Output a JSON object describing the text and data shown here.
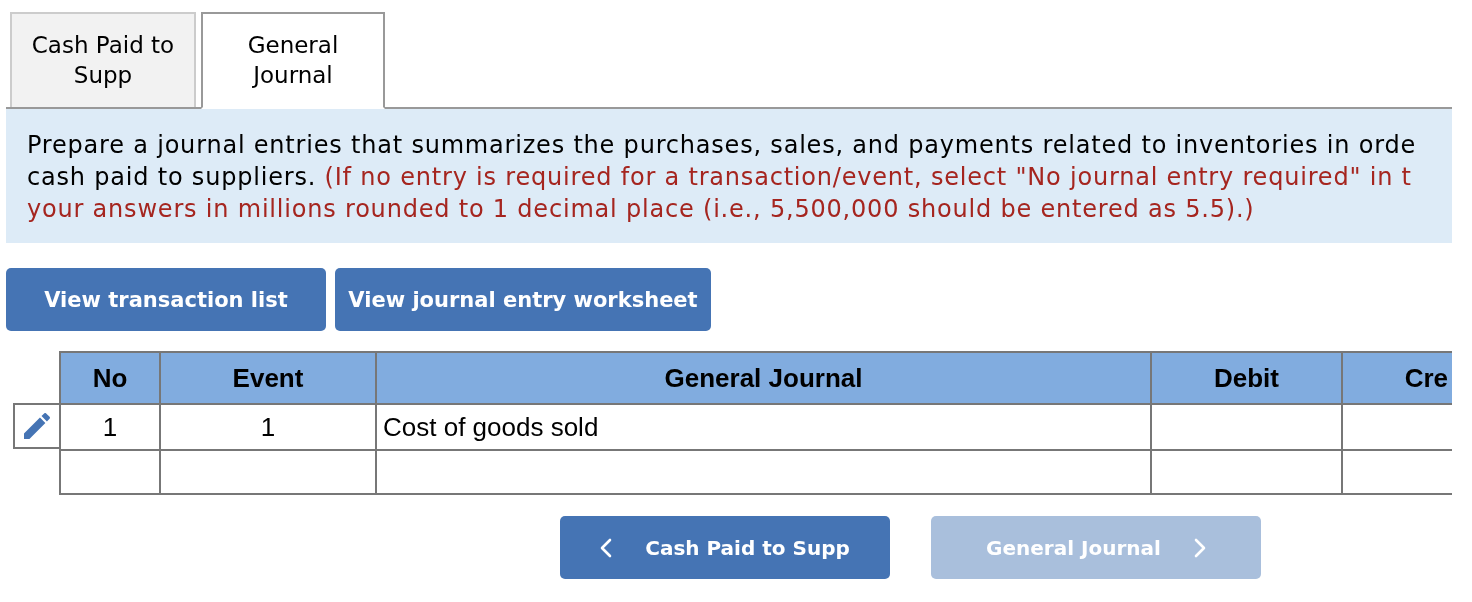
{
  "tabs": [
    {
      "label": "Cash Paid to Supp",
      "selected": false
    },
    {
      "label": "General Journal",
      "selected": true
    }
  ],
  "instructions": {
    "text": "Prepare a journal entries that summarizes the purchases, sales, and payments related to inventories in orde\ncash paid to suppliers. ",
    "note": "(If no entry is required for a transaction/event, select \"No journal entry required\" in t\nyour answers in millions rounded to 1 decimal place (i.e., 5,500,000 should be entered as 5.5).)"
  },
  "actions": [
    "View transaction list",
    "View journal entry worksheet"
  ],
  "table": {
    "columns": [
      "No",
      "Event",
      "General Journal",
      "Debit",
      "Cre"
    ],
    "rows": [
      {
        "editable": true,
        "no": "1",
        "event": "1",
        "account": "Cost of goods sold"
      },
      {
        "editable": false
      }
    ]
  },
  "navigation": [
    {
      "kind": "previous",
      "label": "Cash Paid to Supp",
      "disabled": false
    },
    {
      "kind": "next",
      "label": "General Journal",
      "disabled": true
    }
  ]
}
